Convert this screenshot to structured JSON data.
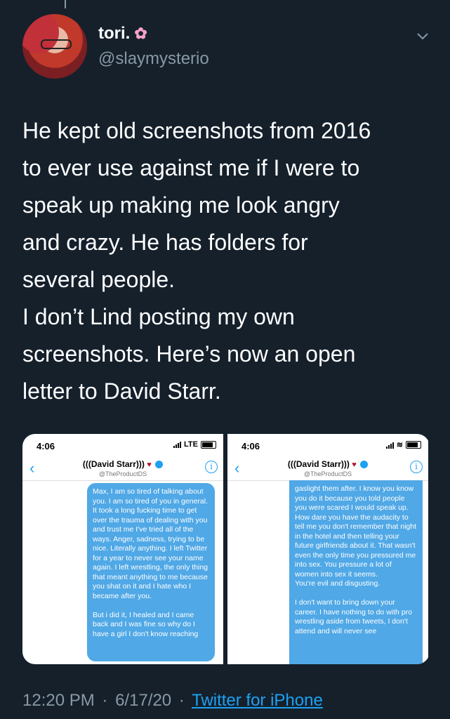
{
  "user": {
    "display_name": "tori.",
    "name_emoji": "✿",
    "handle": "@slaymysterio"
  },
  "tweet": {
    "text": "He kept old screenshots from 2016\nto ever use against me if I were to\nspeak up making me look angry\nand crazy. He has folders for\nseveral people.\nI don’t Lind posting my own\nscreenshots. Here’s now an open\nletter to David Starr."
  },
  "media": {
    "left": {
      "time": "4:06",
      "network": "LTE",
      "title": "(((David Starr)))",
      "subtitle": "@TheProductDS",
      "message": "Max, I am so tired of talking about you. I am so tired of you in general.\nIt took a long fucking time to get over the trauma of dealing with you and trust me I've tried all of the ways. Anger, sadness, trying to be nice. Literally anything. I left Twitter for a year to never see your name again. I left wrestling, the only thing that meant anything to me because you shat on it and I hate who I became after you.\n\nBut i did it, I healed and I came back and I was fine so why do I have a girl I don't know reaching"
    },
    "right": {
      "time": "4:06",
      "title": "(((David Starr)))",
      "subtitle": "@TheProductDS",
      "message": "gaslight them after. I know you know you do it because you told people you were scared I would speak up. How dare you have the audacity to tell me you don't remember that night in the hotel and then telling your future girlfriends about it. That wasn't even the only time you pressured me into sex. You pressure a lot of women into sex it seems.\nYou're evil and disgusting.\n\nI don't want to bring down your career. I have nothing to do with pro wrestling aside from tweets, I don't attend and will never see"
    }
  },
  "footer": {
    "time": "12:20 PM",
    "date": "6/17/20",
    "separator": "·",
    "source": "Twitter for iPhone"
  },
  "colors": {
    "background": "#15202b",
    "secondary_text": "#8899a6",
    "link": "#1da1f2",
    "bubble": "#50a8e6"
  }
}
